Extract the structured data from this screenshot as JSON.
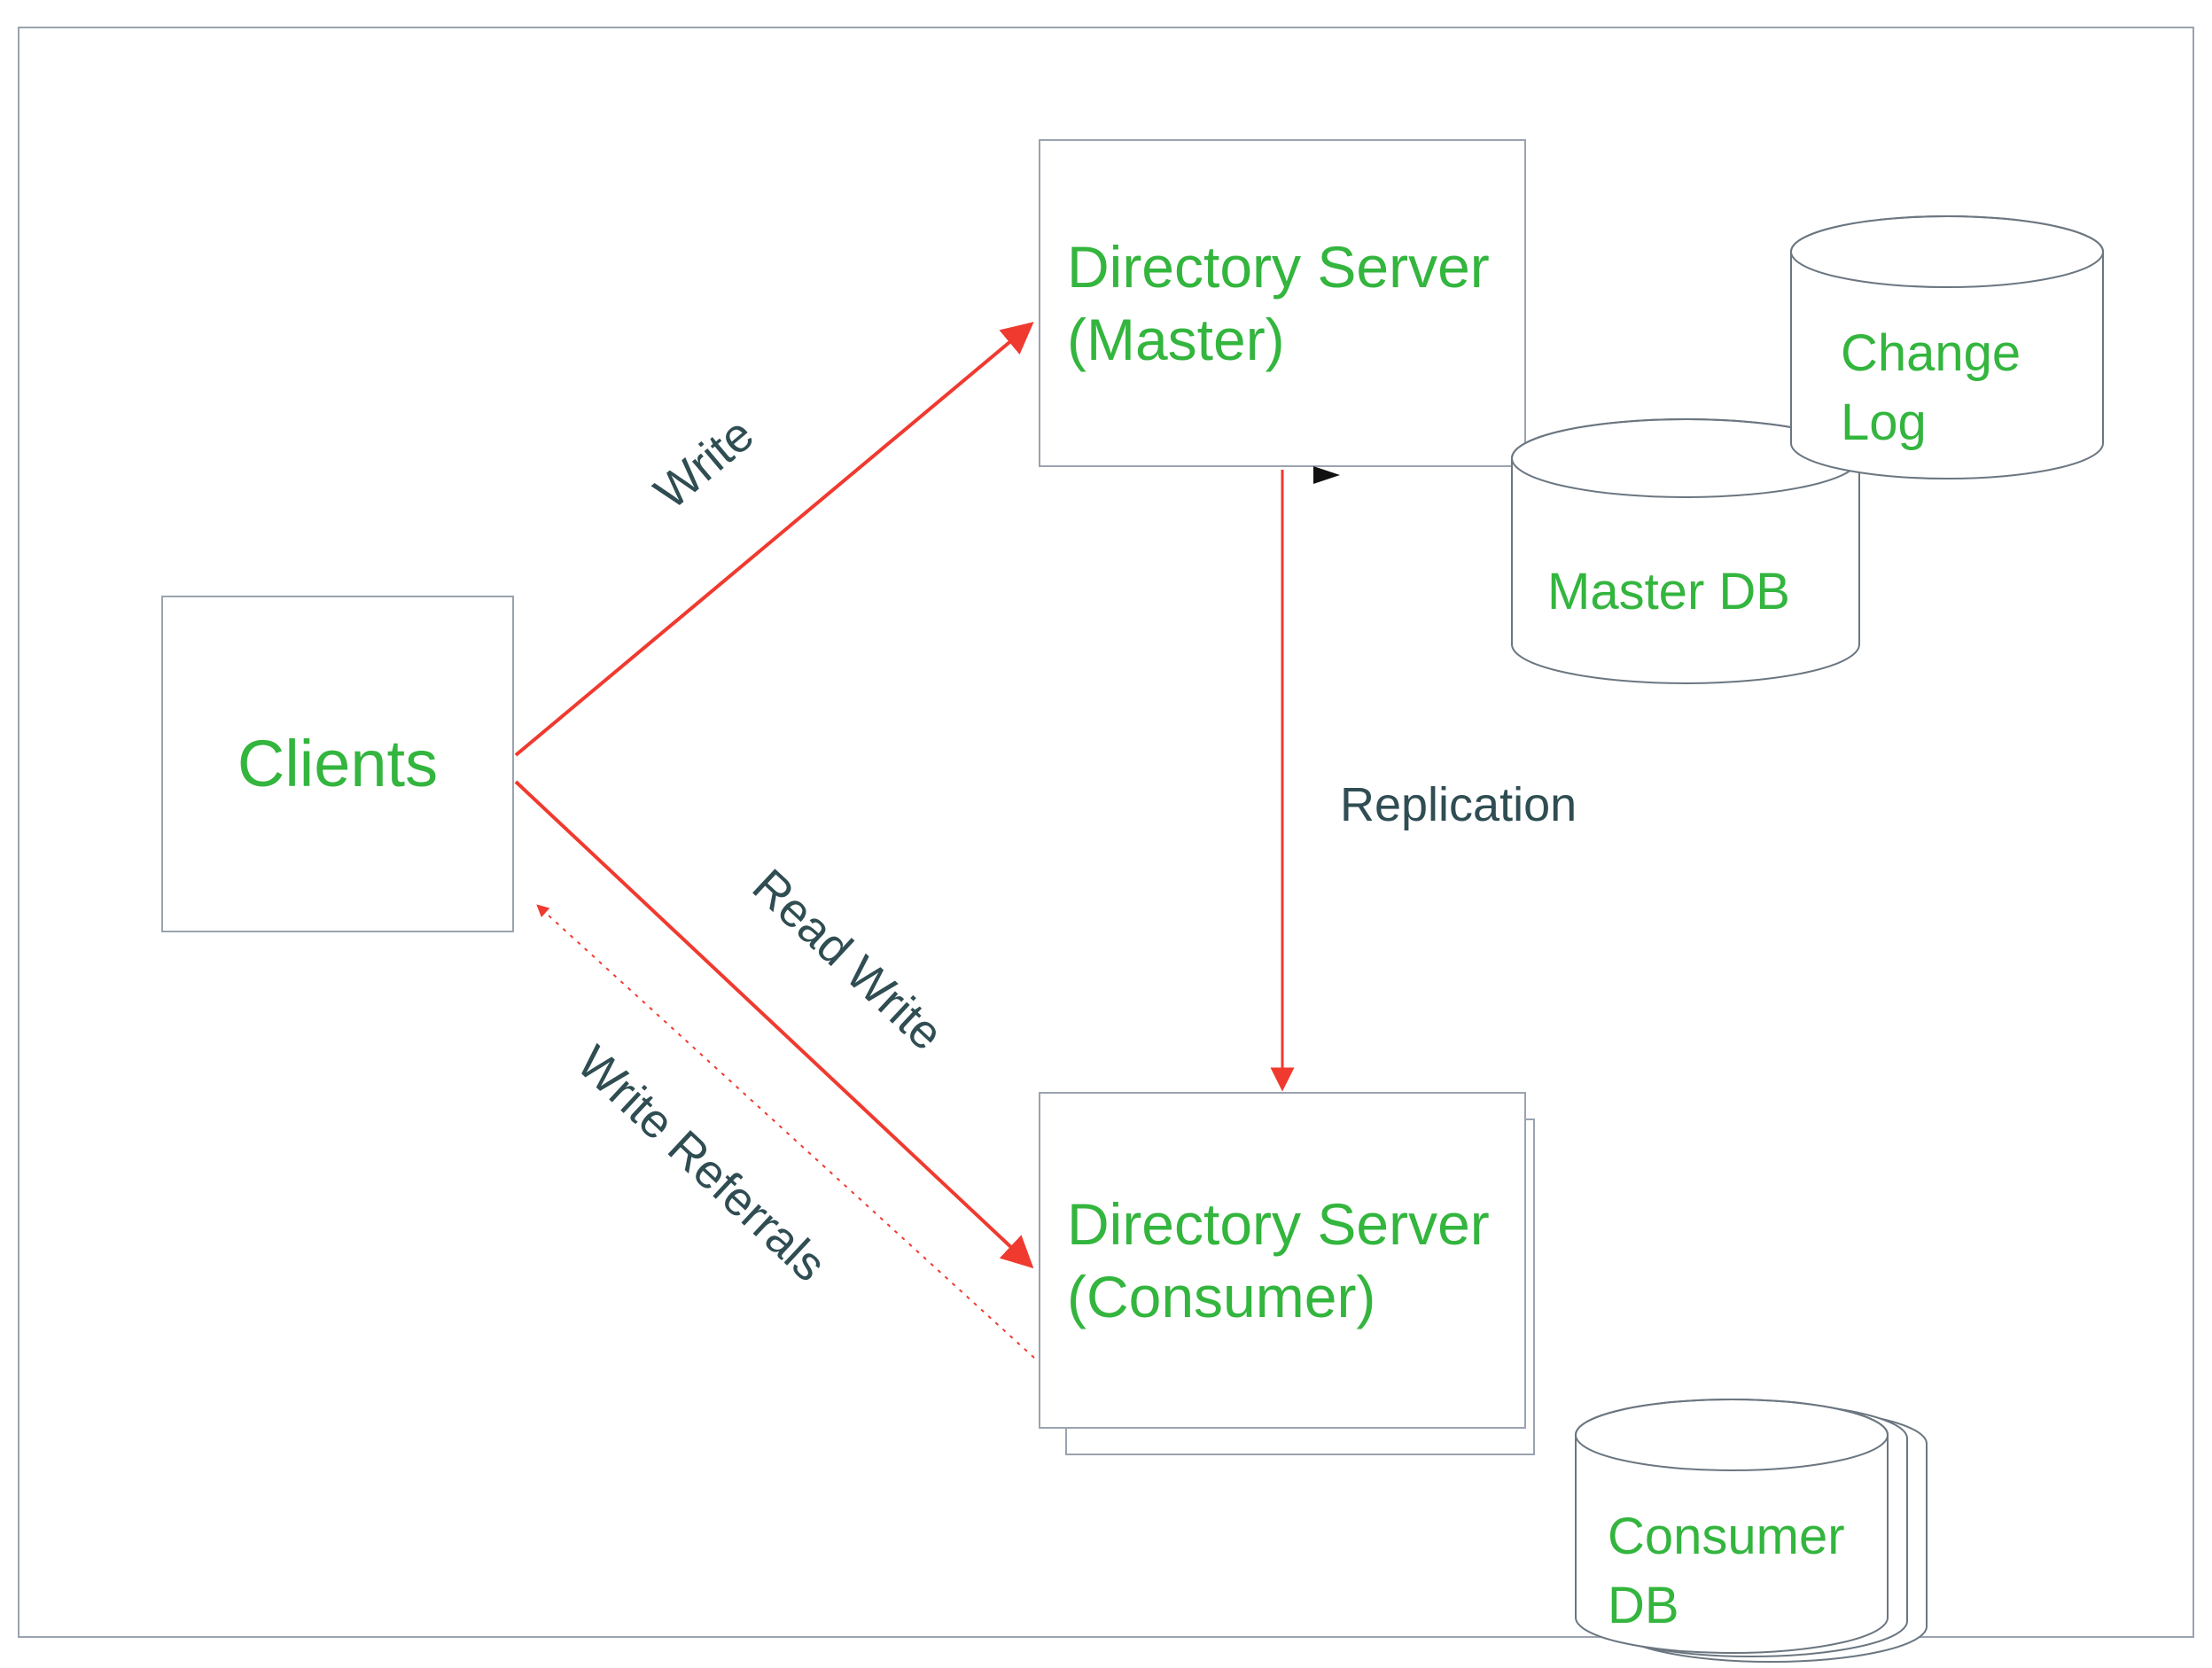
{
  "nodes": {
    "clients": {
      "label": "Clients"
    },
    "master": {
      "label": "Directory Server (Master)"
    },
    "consumer": {
      "label": "Directory Server (Consumer)"
    },
    "master_db": {
      "label": "Master DB"
    },
    "change_log": {
      "label": "Change Log"
    },
    "consumer_db": {
      "label": "Consumer DB"
    }
  },
  "edges": {
    "write": {
      "label": "Write"
    },
    "read_write": {
      "label": "Read Write"
    },
    "write_referrals": {
      "label": "Write Referrals"
    },
    "replication": {
      "label": "Replication"
    }
  },
  "colors": {
    "node_text": "#33b53e",
    "edge_text": "#2f4d52",
    "arrow": "#f03a2f",
    "border": "#9aa3af"
  }
}
